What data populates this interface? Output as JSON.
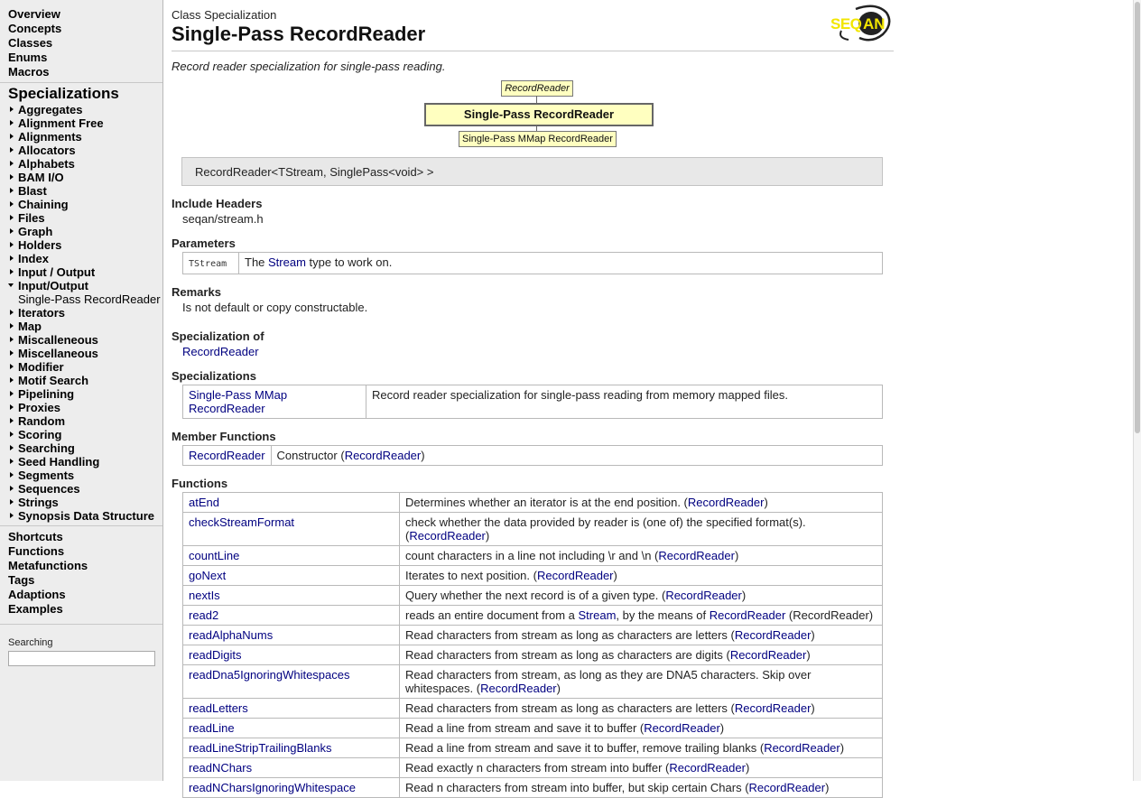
{
  "sidebar": {
    "top_links": [
      "Overview",
      "Concepts",
      "Classes",
      "Enums",
      "Macros"
    ],
    "specializations_heading": "Specializations",
    "specializations": [
      {
        "label": "Aggregates"
      },
      {
        "label": "Alignment Free"
      },
      {
        "label": "Alignments"
      },
      {
        "label": "Allocators"
      },
      {
        "label": "Alphabets"
      },
      {
        "label": "BAM I/O"
      },
      {
        "label": "Blast"
      },
      {
        "label": "Chaining"
      },
      {
        "label": "Files"
      },
      {
        "label": "Graph"
      },
      {
        "label": "Holders"
      },
      {
        "label": "Index"
      },
      {
        "label": "Input / Output"
      },
      {
        "label": "Input/Output",
        "open": true,
        "children": [
          "Single-Pass RecordReader"
        ]
      },
      {
        "label": "Iterators"
      },
      {
        "label": "Map"
      },
      {
        "label": "Miscalleneous"
      },
      {
        "label": "Miscellaneous"
      },
      {
        "label": "Modifier"
      },
      {
        "label": "Motif Search"
      },
      {
        "label": "Pipelining"
      },
      {
        "label": "Proxies"
      },
      {
        "label": "Random"
      },
      {
        "label": "Scoring"
      },
      {
        "label": "Searching"
      },
      {
        "label": "Seed Handling"
      },
      {
        "label": "Segments"
      },
      {
        "label": "Sequences"
      },
      {
        "label": "Strings"
      },
      {
        "label": "Synopsis Data Structure"
      }
    ],
    "bottom_links": [
      "Shortcuts",
      "Functions",
      "Metafunctions",
      "Tags",
      "Adaptions",
      "Examples"
    ],
    "search_label": "Searching",
    "search_value": ""
  },
  "page": {
    "kind": "Class Specialization",
    "title": "Single-Pass RecordReader",
    "summary": "Record reader specialization for single-pass reading.",
    "logo_text": "SEQAN",
    "diagram": {
      "parent": "RecordReader",
      "current": "Single-Pass RecordReader",
      "child": "Single-Pass MMap RecordReader"
    },
    "signature": "RecordReader<TStream, SinglePass<void> >",
    "include_headers_heading": "Include Headers",
    "include_header": "seqan/stream.h",
    "parameters_heading": "Parameters",
    "parameters": [
      {
        "name": "TStream",
        "desc_pre": "The ",
        "desc_link": "Stream",
        "desc_post": " type to work on."
      }
    ],
    "remarks_heading": "Remarks",
    "remarks": "Is not default or copy constructable.",
    "specialization_of_heading": "Specialization of",
    "specialization_of": "RecordReader",
    "specializations_heading": "Specializations",
    "specializations": [
      {
        "name": "Single-Pass MMap RecordReader",
        "desc": "Record reader specialization for single-pass reading from memory mapped files."
      }
    ],
    "member_functions_heading": "Member Functions",
    "member_functions": [
      {
        "name": "RecordReader",
        "desc_pre": "Constructor (",
        "desc_link": "RecordReader",
        "desc_post": ")"
      }
    ],
    "functions_heading": "Functions",
    "functions": [
      {
        "name": "atEnd",
        "desc": "Determines whether an iterator is at the end position. (",
        "link": "RecordReader",
        "post": ")"
      },
      {
        "name": "checkStreamFormat",
        "desc": "check whether the data provided by reader is (one of) the specified format(s). (",
        "link": "RecordReader",
        "post": ")"
      },
      {
        "name": "countLine",
        "desc": "count characters in a line not including \\r and \\n (",
        "link": "RecordReader",
        "post": ")"
      },
      {
        "name": "goNext",
        "desc": "Iterates to next position. (",
        "link": "RecordReader",
        "post": ")"
      },
      {
        "name": "nextIs",
        "desc": "Query whether the next record is of a given type. (",
        "link": "RecordReader",
        "post": ")"
      },
      {
        "name": "read2",
        "desc": "reads an entire document from a ",
        "mid_link": "Stream",
        "mid": ", by the means of ",
        "link": "RecordReader",
        "post": " (RecordReader)"
      },
      {
        "name": "readAlphaNums",
        "desc": "Read characters from stream as long as characters are letters (",
        "link": "RecordReader",
        "post": ")"
      },
      {
        "name": "readDigits",
        "desc": "Read characters from stream as long as characters are digits (",
        "link": "RecordReader",
        "post": ")"
      },
      {
        "name": "readDna5IgnoringWhitespaces",
        "desc": "Read characters from stream, as long as they are DNA5 characters. Skip over whitespaces. (",
        "link": "RecordReader",
        "post": ")"
      },
      {
        "name": "readLetters",
        "desc": "Read characters from stream as long as characters are letters (",
        "link": "RecordReader",
        "post": ")"
      },
      {
        "name": "readLine",
        "desc": "Read a line from stream and save it to buffer (",
        "link": "RecordReader",
        "post": ")"
      },
      {
        "name": "readLineStripTrailingBlanks",
        "desc": "Read a line from stream and save it to buffer, remove trailing blanks (",
        "link": "RecordReader",
        "post": ")"
      },
      {
        "name": "readNChars",
        "desc": "Read exactly n characters from stream into buffer (",
        "link": "RecordReader",
        "post": ")"
      },
      {
        "name": "readNCharsIgnoringWhitespace",
        "desc": "Read n characters from stream into buffer, but skip certain Chars (",
        "link": "RecordReader",
        "post": ")"
      }
    ]
  },
  "colors": {
    "link": "#000080",
    "sidebar_bg": "#ededed",
    "diagram_box": "#ffffc0",
    "signature_bg": "#e8e8e8",
    "logo_yellow": "#f2e600"
  }
}
